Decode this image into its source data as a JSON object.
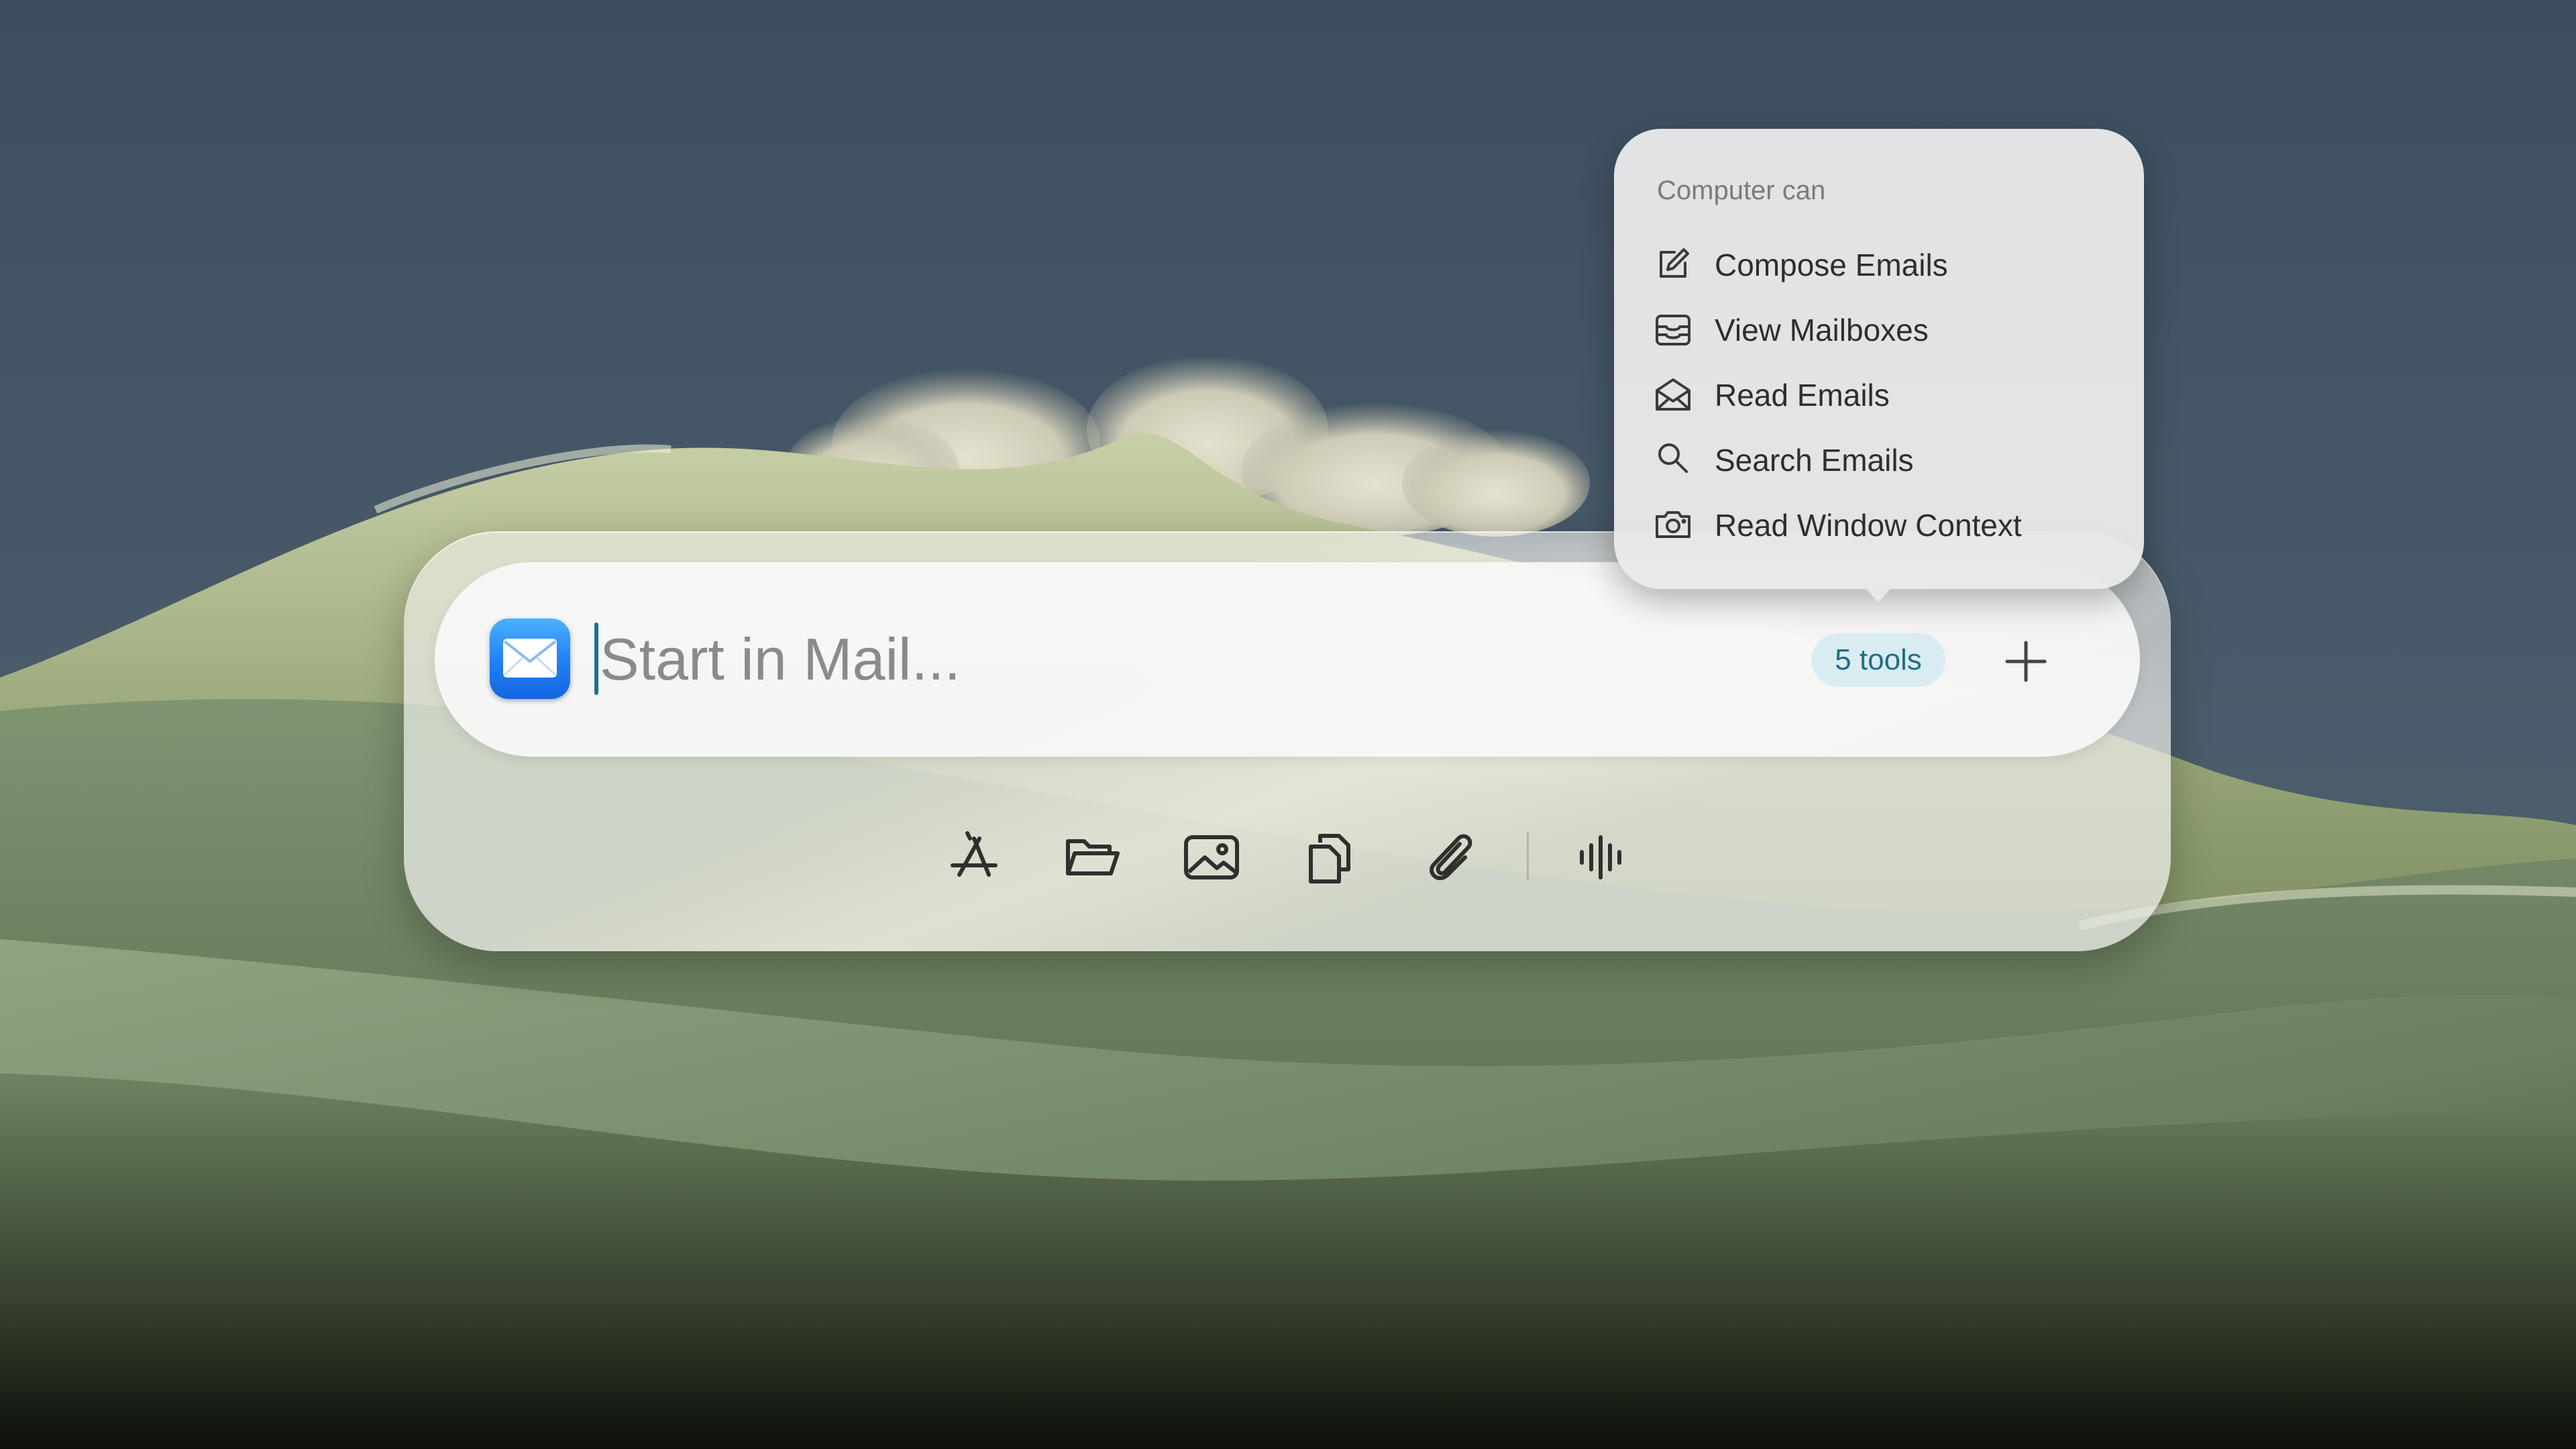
{
  "input": {
    "placeholder": "Start in Mail...",
    "app_icon": "mail-app-icon"
  },
  "tools_badge": {
    "label": "5 tools",
    "background": "#d9ecf1",
    "text_color": "#1f6f86"
  },
  "add_button": {
    "icon": "plus-icon"
  },
  "toolbar": {
    "icons": [
      "app-store-icon",
      "folder-icon",
      "image-icon",
      "documents-icon",
      "paperclip-icon",
      "waveform-icon"
    ]
  },
  "popover": {
    "heading": "Computer can",
    "items": [
      {
        "label": "Compose Emails",
        "icon": "compose-icon"
      },
      {
        "label": "View Mailboxes",
        "icon": "mailbox-tray-icon"
      },
      {
        "label": "Read Emails",
        "icon": "open-envelope-icon"
      },
      {
        "label": "Search Emails",
        "icon": "search-icon"
      },
      {
        "label": "Read Window Context",
        "icon": "camera-icon"
      }
    ]
  },
  "colors": {
    "caret": "#1d6f8f",
    "mail_icon": "#1f7ff2",
    "sky": "#3f5163",
    "dunes": "#5b6d52"
  }
}
